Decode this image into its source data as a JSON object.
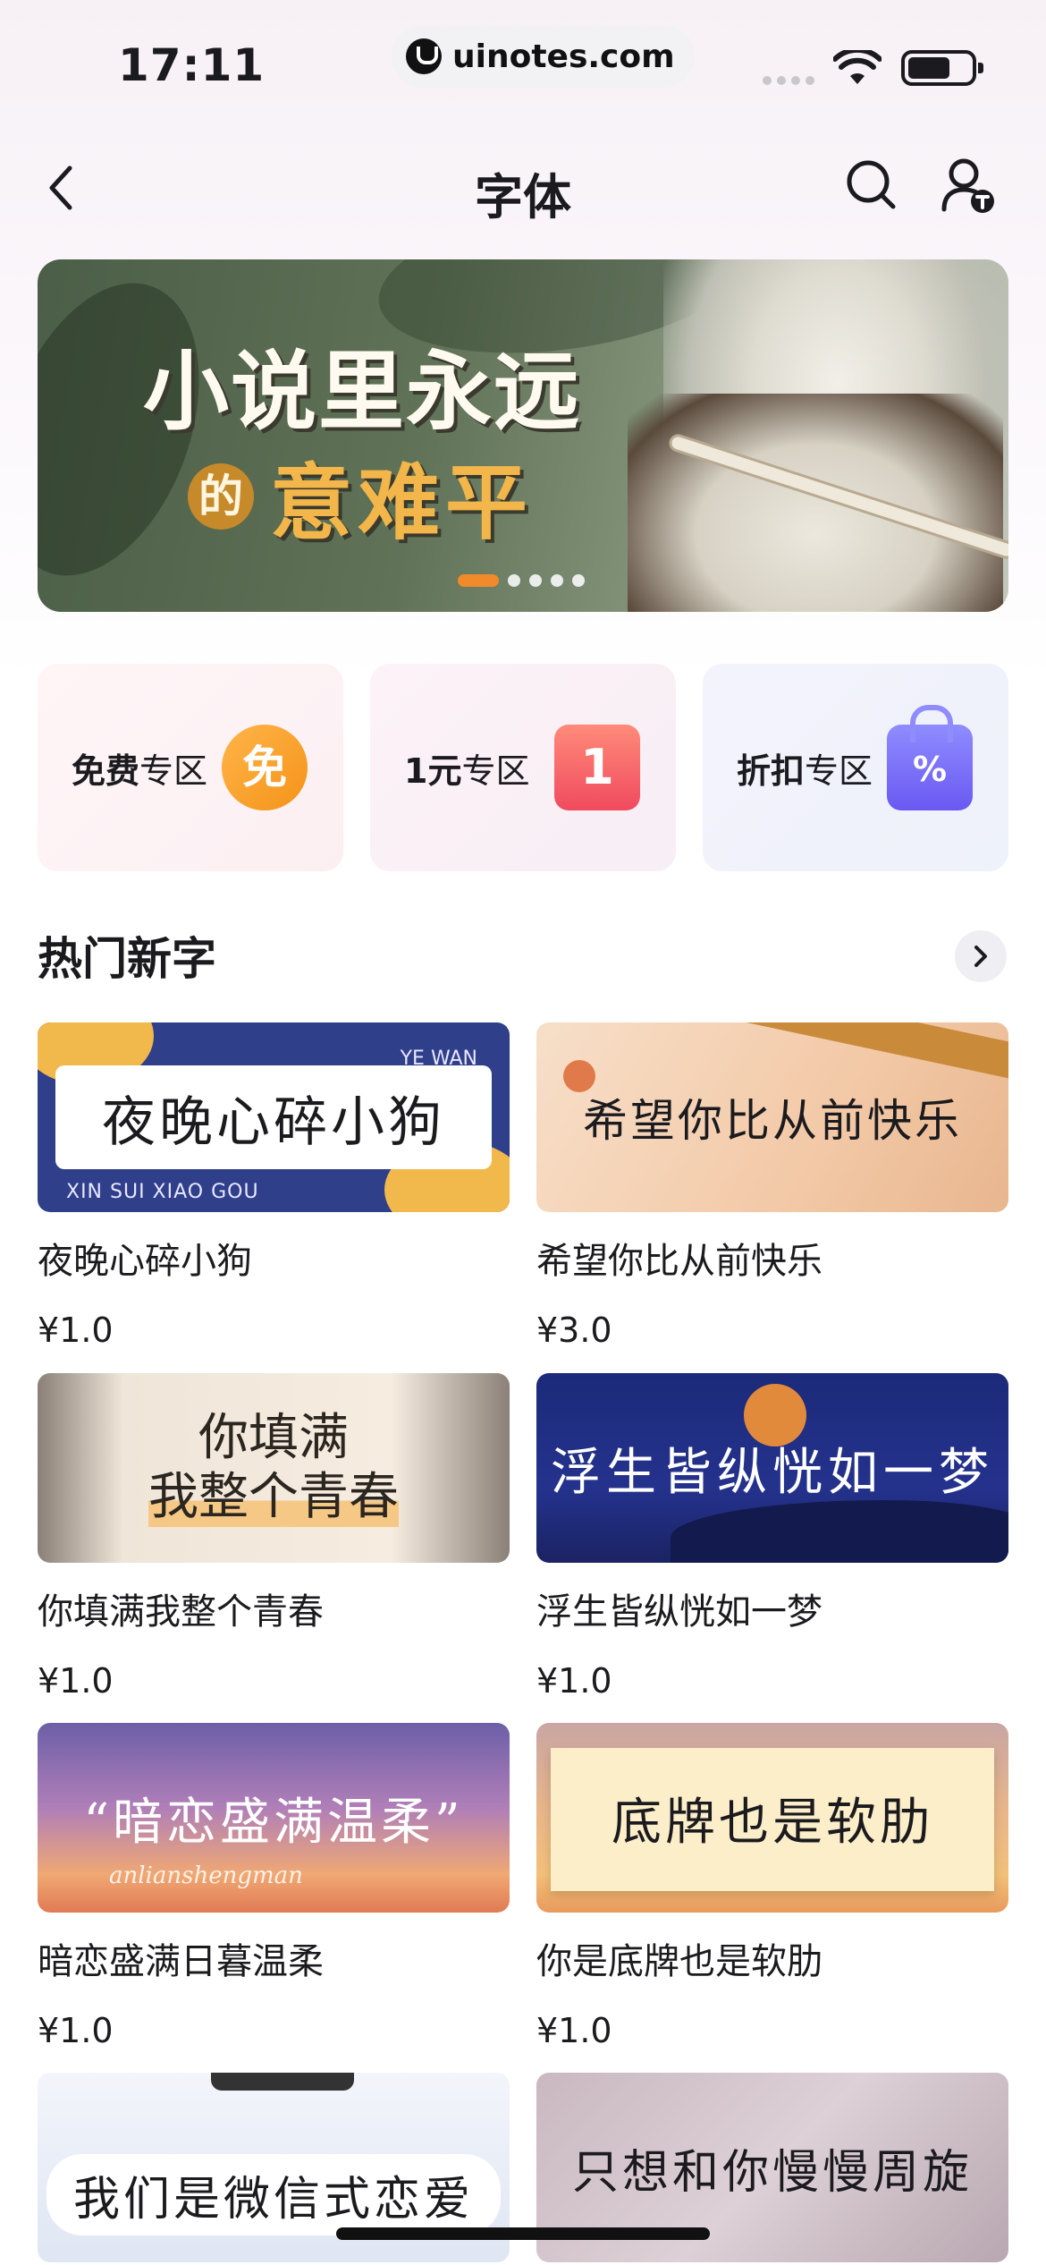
{
  "status_bar": {
    "time": "17:11",
    "url": "uinotes.com"
  },
  "nav": {
    "title": "字体"
  },
  "banner": {
    "line1": "小说里永远",
    "line2_prefix": "的",
    "line2": "意难平"
  },
  "zones": [
    {
      "label_bold": "免费",
      "label_rest": "专区",
      "badge": "免"
    },
    {
      "label_bold": "1元",
      "label_rest": "专区",
      "badge": "1"
    },
    {
      "label_bold": "折扣",
      "label_rest": "专区",
      "badge": "%"
    }
  ],
  "section": {
    "title": "热门新字"
  },
  "fonts": [
    {
      "preview": "夜晚心碎小狗",
      "tag_left": "XIN SUI XIAO GOU",
      "tag_right": "YE WAN",
      "name": "夜晚心碎小狗",
      "price": "¥1.0"
    },
    {
      "preview": "希望你比从前快乐",
      "name": "希望你比从前快乐",
      "price": "¥3.0"
    },
    {
      "preview_line1": "你填满",
      "preview_line2": "我整个青春",
      "name": "你填满我整个青春",
      "price": "¥1.0"
    },
    {
      "preview": "浮生皆纵恍如一梦",
      "name": "浮生皆纵恍如一梦",
      "price": "¥1.0"
    },
    {
      "preview": "“暗恋盛满温柔”",
      "sub": "anlianshengman",
      "name": "暗恋盛满日暮温柔",
      "price": "¥1.0"
    },
    {
      "preview": "底牌也是软肋",
      "name": "你是底牌也是软肋",
      "price": "¥1.0"
    },
    {
      "preview": "我们是微信式恋爱",
      "name": "",
      "price": ""
    },
    {
      "preview": "只想和你慢慢周旋",
      "name": "",
      "price": ""
    }
  ]
}
